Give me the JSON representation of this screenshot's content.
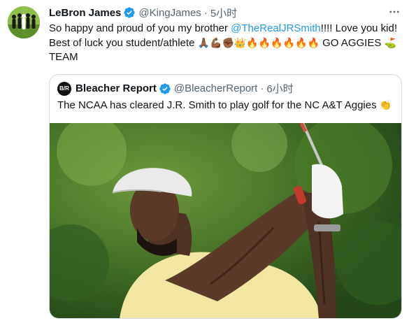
{
  "tweet": {
    "author_name": "LeBron James",
    "handle": "@KingJames",
    "separator": "·",
    "time": "5小时",
    "text_before_mention": "So happy and proud of you my brother ",
    "mention": "@TheRealJRSmith",
    "text_after_mention": "!!!! Love you kid! Best of luck you student/athlete ",
    "emojis_line": "🙏🏾💪🏾✊🏾👑🔥🔥🔥🔥🔥🔥",
    "text_after_emojis": " GO AGGIES ",
    "emoji_golf": "⛳",
    "text_end": " TEAM",
    "avatar_icon": "group-photo-avatar",
    "verified_color": "#1d9bf0"
  },
  "quote": {
    "author_name": "Bleacher Report",
    "avatar_text": "B/R",
    "handle": "@BleacherReport",
    "separator": "·",
    "time": "6小时",
    "text": "The NCAA has cleared J.R. Smith to play golf for the NC A&T Aggies ",
    "emoji": "👏",
    "image_icon": "golfer-photo"
  },
  "colors": {
    "link": "#1d9bf0",
    "secondary_text": "#536471",
    "border": "#cfd9de"
  }
}
